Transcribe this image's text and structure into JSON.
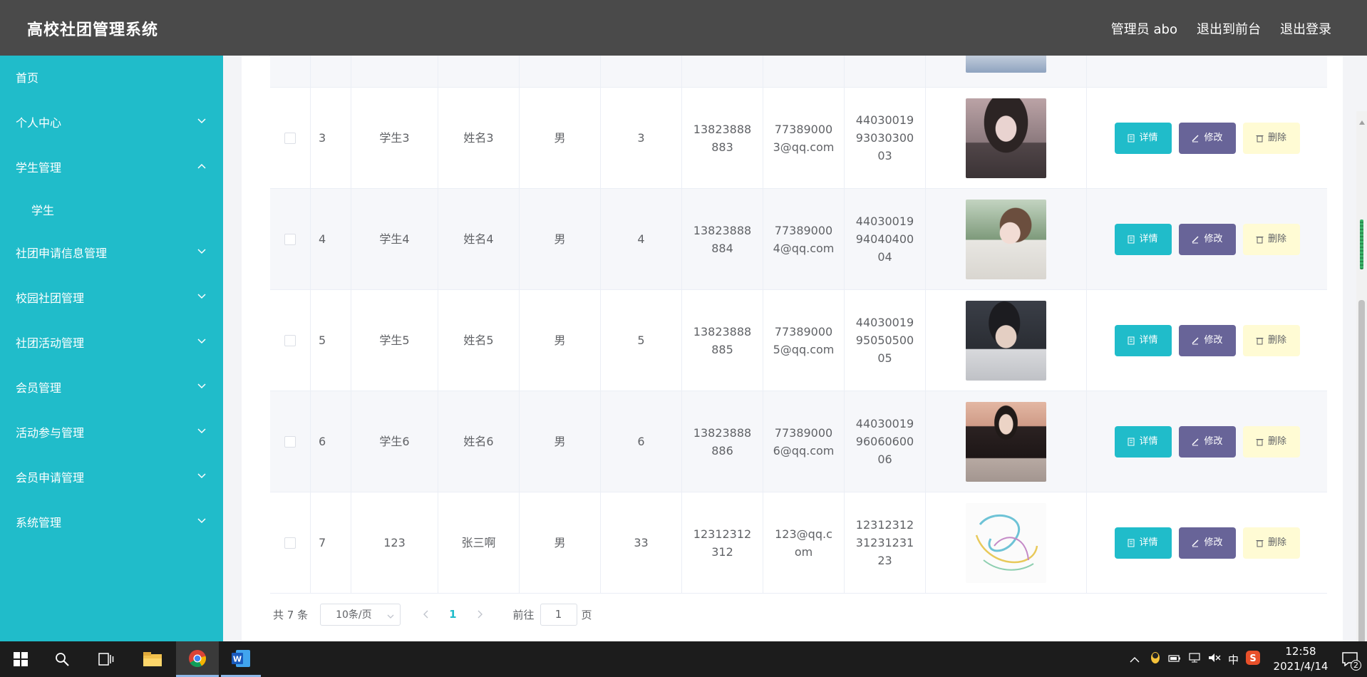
{
  "header": {
    "app_title": "高校社团管理系统",
    "admin_label": "管理员 abo",
    "back_to_front": "退出到前台",
    "logout": "退出登录"
  },
  "sidebar": {
    "items": [
      {
        "label": "首页",
        "chevron": "none"
      },
      {
        "label": "个人中心",
        "chevron": "down"
      },
      {
        "label": "学生管理",
        "chevron": "up"
      },
      {
        "label": "学生",
        "chevron": "none",
        "sub": true
      },
      {
        "label": "社团申请信息管理",
        "chevron": "down"
      },
      {
        "label": "校园社团管理",
        "chevron": "down"
      },
      {
        "label": "社团活动管理",
        "chevron": "down"
      },
      {
        "label": "会员管理",
        "chevron": "down"
      },
      {
        "label": "活动参与管理",
        "chevron": "down"
      },
      {
        "label": "会员申请管理",
        "chevron": "down"
      },
      {
        "label": "系统管理",
        "chevron": "down"
      }
    ]
  },
  "table": {
    "buttons": {
      "detail": "详情",
      "edit": "修改",
      "delete": "删除"
    },
    "rows": [
      {
        "idx": "3",
        "account": "学生3",
        "name": "姓名3",
        "gender": "男",
        "age": "3",
        "phone": "13823888883",
        "email": "773890003@qq.com",
        "idcard": "440300199303030003",
        "photo": "portrait-scarf"
      },
      {
        "idx": "4",
        "account": "学生4",
        "name": "姓名4",
        "gender": "男",
        "age": "4",
        "phone": "13823888884",
        "email": "773890004@qq.com",
        "idcard": "440300199404040004",
        "photo": "portrait-ponytail"
      },
      {
        "idx": "5",
        "account": "学生5",
        "name": "姓名5",
        "gender": "男",
        "age": "5",
        "phone": "13823888885",
        "email": "773890005@qq.com",
        "idcard": "440300199505050005",
        "photo": "portrait-boy"
      },
      {
        "idx": "6",
        "account": "学生6",
        "name": "姓名6",
        "gender": "男",
        "age": "6",
        "phone": "13823888886",
        "email": "773890006@qq.com",
        "idcard": "440300199606060006",
        "photo": "portrait-black-top"
      },
      {
        "idx": "7",
        "account": "123",
        "name": "张三啊",
        "gender": "男",
        "age": "33",
        "phone": "12312312312",
        "email": "123@qq.com",
        "idcard": "123123123123123123",
        "photo": "swirl-art"
      }
    ]
  },
  "pagination": {
    "total": "共 7 条",
    "page_size": "10条/页",
    "current_page": "1",
    "jump_label": "前往",
    "jump_value": "1",
    "jump_suffix": "页"
  },
  "taskbar": {
    "time": "12:58",
    "date": "2021/4/14",
    "ime": "中",
    "notifications": "2"
  },
  "colors": {
    "sidebar": "#20bcca",
    "header": "#4a4a4a",
    "detail_btn": "#20bcca",
    "edit_btn": "#686498",
    "delete_btn": "#fffbd4"
  }
}
